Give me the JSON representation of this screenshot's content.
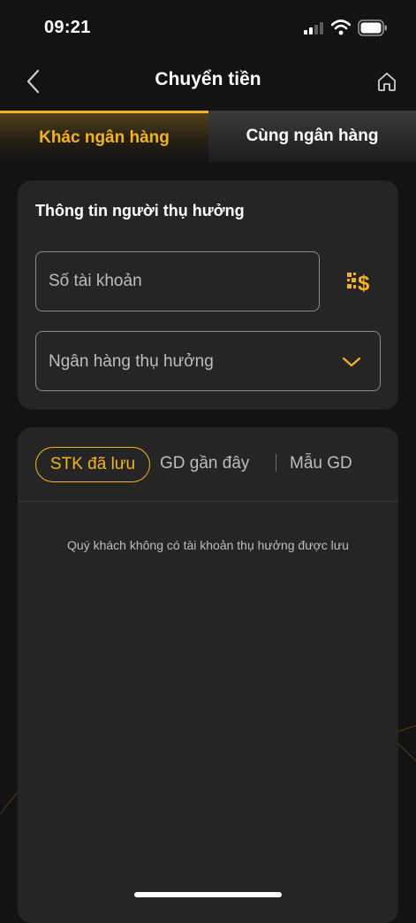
{
  "status_bar": {
    "time": "09:21"
  },
  "nav": {
    "title": "Chuyển tiền",
    "back_icon": "chevron-left-icon",
    "home_icon": "home-icon"
  },
  "tabs": [
    {
      "label": "Khác ngân hàng",
      "active": true
    },
    {
      "label": "Cùng ngân hàng",
      "active": false
    }
  ],
  "beneficiary": {
    "title": "Thông tin người thụ hưởng",
    "account_placeholder": "Số tài khoản",
    "account_value": "",
    "qr_icon": "qr-money-icon",
    "bank_placeholder": "Ngân hàng thụ hưởng",
    "bank_chevron_icon": "chevron-down-icon"
  },
  "saved": {
    "tabs": [
      {
        "label": "STK đã lưu",
        "active": true
      },
      {
        "label": "GD gần đây",
        "active": false
      },
      {
        "label": "Mẫu GD",
        "active": false
      }
    ],
    "empty_message": "Quý khách không có tài khoản thụ hưởng được lưu"
  },
  "colors": {
    "accent": "#f5b324",
    "background": "#131313",
    "card": "#252525",
    "muted_text": "#bdbdbd",
    "border": "#8a8a8a"
  }
}
